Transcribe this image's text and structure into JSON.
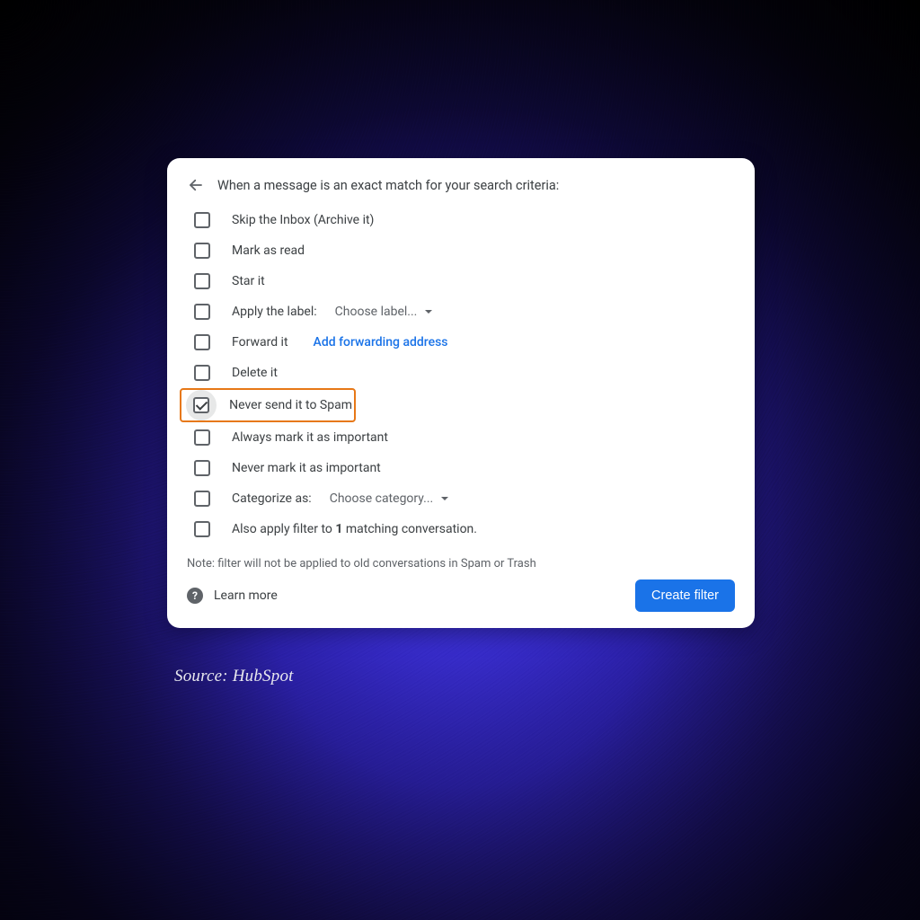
{
  "header": {
    "title": "When a message is an exact match for your search criteria:"
  },
  "options": {
    "skip_inbox": "Skip the Inbox (Archive it)",
    "mark_read": "Mark as read",
    "star": "Star it",
    "apply_label": "Apply the label:",
    "apply_label_value": "Choose label...",
    "forward": "Forward it",
    "forward_link": "Add forwarding address",
    "delete": "Delete it",
    "never_spam": "Never send it to Spam",
    "always_important": "Always mark it as important",
    "never_important": "Never mark it as important",
    "categorize": "Categorize as:",
    "categorize_value": "Choose category...",
    "also_apply_prefix": "Also apply filter to ",
    "also_apply_count": "1",
    "also_apply_suffix": " matching conversation."
  },
  "note": "Note: filter will not be applied to old conversations in Spam or Trash",
  "learn_more": "Learn more",
  "create_button": "Create filter",
  "source_caption": "Source: HubSpot"
}
